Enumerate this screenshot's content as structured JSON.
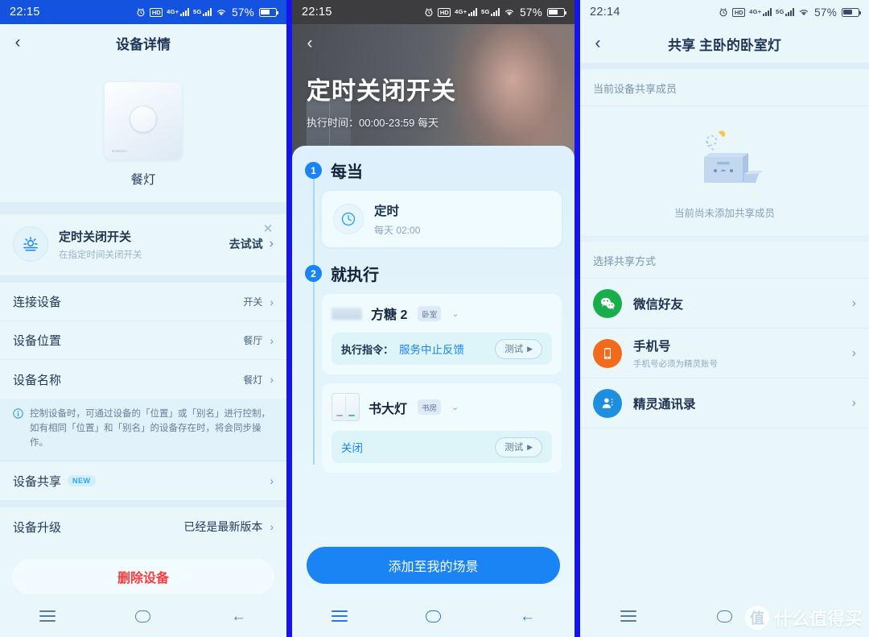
{
  "status_bars": {
    "left": {
      "time": "22:15",
      "battery_pct": "57%",
      "hd": "HD",
      "net1": "4G+",
      "net2": "5G"
    },
    "middle": {
      "time": "22:15",
      "battery_pct": "57%",
      "hd": "HD",
      "net1": "4G+",
      "net2": "5G"
    },
    "right": {
      "time": "22:14",
      "battery_pct": "57%",
      "hd": "HD",
      "net1": "4G+",
      "net2": "5G"
    }
  },
  "panel1": {
    "nav": {
      "back": "‹",
      "title": "设备详情"
    },
    "device": {
      "name": "餐灯",
      "brand_mark": "SOWOSO"
    },
    "promo": {
      "title": "定时关闭开关",
      "subtitle": "在指定时间关闭开关",
      "cta": "去试试",
      "close": "✕"
    },
    "rows": [
      {
        "label": "连接设备",
        "value": "开关"
      },
      {
        "label": "设备位置",
        "value": "餐厅"
      },
      {
        "label": "设备名称",
        "value": "餐灯"
      }
    ],
    "tip": "控制设备时，可通过设备的「位置」或「别名」进行控制，如有相同「位置」和「别名」的设备存在时，将会同步操作。",
    "share_row": {
      "label": "设备共享",
      "badge": "NEW"
    },
    "upgrade_row": {
      "label": "设备升级",
      "value": "已经是最新版本"
    },
    "delete_button": "删除设备"
  },
  "panel2": {
    "nav": {
      "back": "‹"
    },
    "hero": {
      "title": "定时关闭开关",
      "subtitle": "执行时间：00:00-23:59 每天"
    },
    "step1": {
      "num": "1",
      "title": "每当",
      "card": {
        "title": "定时",
        "subtitle": "每天 02:00"
      }
    },
    "step2": {
      "num": "2",
      "title": "就执行",
      "devices": [
        {
          "name": "方糖 2",
          "room": "卧室",
          "action_label": "执行指令：",
          "action_value": "服务中止反馈",
          "test": "测试"
        },
        {
          "name": "书大灯",
          "room": "书房",
          "action_label": "",
          "action_value": "关闭",
          "test": "测试"
        }
      ]
    },
    "cta": "添加至我的场景"
  },
  "panel3": {
    "nav": {
      "back": "‹",
      "title": "共享 主卧的卧室灯"
    },
    "section_members": "当前设备共享成员",
    "empty_text": "当前尚未添加共享成员",
    "section_methods": "选择共享方式",
    "methods": [
      {
        "icon": "wechat-icon",
        "title": "微信好友",
        "subtitle": "",
        "color": "#1aad4b"
      },
      {
        "icon": "phone-icon",
        "title": "手机号",
        "subtitle": "手机号必须为精灵账号",
        "color": "#f26a1b"
      },
      {
        "icon": "contacts-icon",
        "title": "精灵通讯录",
        "subtitle": "",
        "color": "#1e8fe0"
      }
    ]
  },
  "bottom_nav": {
    "menu": "menu-icon",
    "home": "home-icon",
    "back": "back-icon"
  },
  "watermark": {
    "logo": "值",
    "text": "什么值得买"
  },
  "colors": {
    "accent_blue": "#1a84f5",
    "status_blue": "#1452e0",
    "divider_blue": "#1414ee",
    "page_bg": "#e9f7fb",
    "danger_red": "#fb3b3b"
  }
}
